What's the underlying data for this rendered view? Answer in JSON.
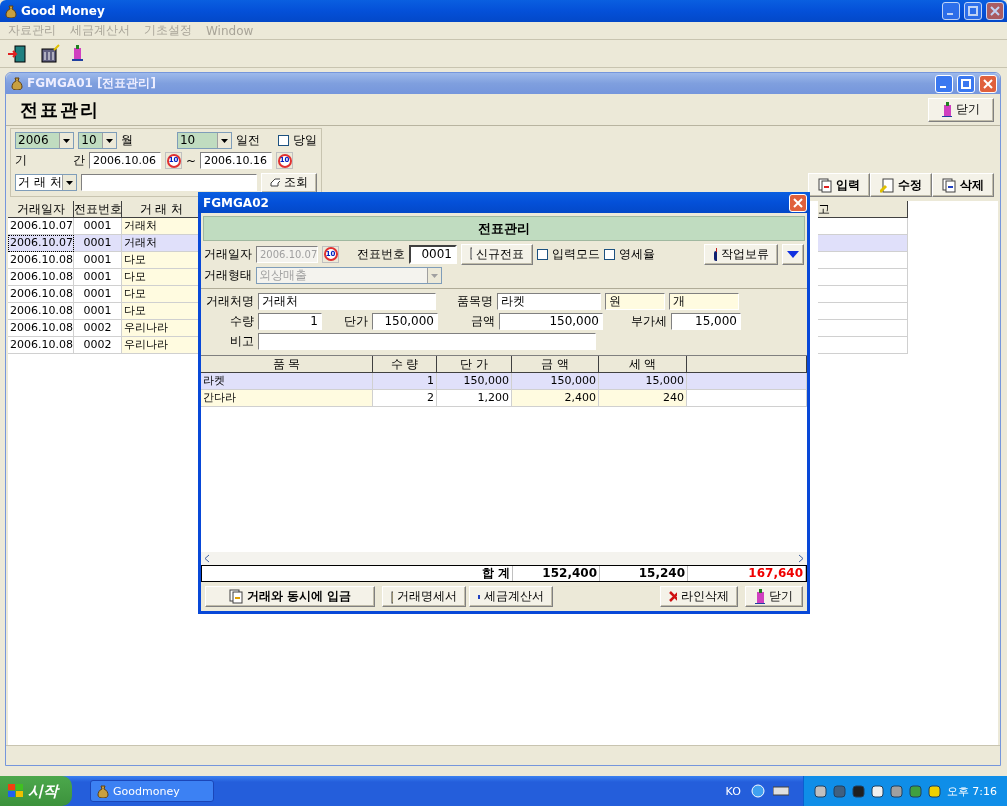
{
  "window": {
    "title": "Good Money"
  },
  "menu": [
    {
      "label": "자료관리",
      "disabled": true
    },
    {
      "label": "세금계산서",
      "disabled": true
    },
    {
      "label": "기초설정",
      "disabled": true
    },
    {
      "label": "Window",
      "disabled": true
    }
  ],
  "child_window": {
    "title": "FGMGA01 [전표관리]",
    "heading": "전표관리",
    "close_button": "닫기",
    "filter": {
      "year": "2006",
      "month": "10",
      "month_label": "월",
      "days": "10",
      "days_label": "일전",
      "today": {
        "label": "당일",
        "checked": false
      },
      "period_label_1": "기",
      "period_label_2": "간",
      "date_from": "2006.10.06",
      "date_to": "2006.10.16",
      "calendar_icon_from": "10",
      "calendar_icon_to": "10",
      "range_sep": "~",
      "field_select": "거 래 처",
      "search_button": "조회"
    },
    "actions": [
      "입력",
      "수정",
      "삭제"
    ],
    "table": {
      "columns": [
        "거래일자",
        "전표번호",
        "거 래 처",
        "고"
      ],
      "rows": [
        {
          "cells": [
            "2006.10.07",
            "0001",
            "거래처"
          ],
          "selected": false
        },
        {
          "cells": [
            "2006.10.07",
            "0001",
            "거래처"
          ],
          "selected": true
        },
        {
          "cells": [
            "2006.10.08",
            "0001",
            "다모"
          ],
          "selected": false
        },
        {
          "cells": [
            "2006.10.08",
            "0001",
            "다모"
          ],
          "selected": false
        },
        {
          "cells": [
            "2006.10.08",
            "0001",
            "다모"
          ],
          "selected": false
        },
        {
          "cells": [
            "2006.10.08",
            "0001",
            "다모"
          ],
          "selected": false
        },
        {
          "cells": [
            "2006.10.08",
            "0002",
            "우리나라"
          ],
          "selected": false
        },
        {
          "cells": [
            "2006.10.08",
            "0002",
            "우리나라"
          ],
          "selected": false
        }
      ]
    }
  },
  "dialog": {
    "title": "FGMGA02",
    "heading": "전표관리",
    "form": {
      "date_label": "거래일자",
      "date": "2006.10.07",
      "date_disabled": true,
      "calendar_icon": "10",
      "slip_label": "전표번호",
      "slip_no": "0001",
      "new_slip_button": "신규전표",
      "input_mode": {
        "label": "입력모드",
        "checked": false
      },
      "zero_rate": {
        "label": "영세율",
        "checked": false
      },
      "hold_button": "작업보류",
      "type_label": "거래형태",
      "type": "외상매출",
      "type_disabled": true,
      "partner_label": "거래처명",
      "partner": "거래처",
      "item_label": "품목명",
      "item": "라켓",
      "unit_1": "원",
      "unit_2": "개",
      "qty_label": "수량",
      "qty": "1",
      "price_label": "단가",
      "price": "150,000",
      "amount_label": "금액",
      "amount": "150,000",
      "vat_label": "부가세",
      "vat": "15,000",
      "memo_label": "비고"
    },
    "grid": {
      "columns": [
        "품 목",
        "수 량",
        "단 가",
        "금 액",
        "세 액"
      ],
      "rows": [
        {
          "cells": [
            "라켓",
            "1",
            "150,000",
            "150,000",
            "15,000"
          ],
          "selected": true
        },
        {
          "cells": [
            "간다라",
            "2",
            "1,200",
            "2,400",
            "240"
          ],
          "selected": false
        }
      ]
    },
    "totals": {
      "label": "합 계",
      "values": [
        "152,400",
        "15,240",
        "167,640"
      ]
    },
    "buttons": [
      {
        "label": "거래와 동시에 입금",
        "kind": "deposit"
      },
      {
        "label": "거래명세서",
        "kind": "statement"
      },
      {
        "label": "세금계산서",
        "kind": "invoice"
      },
      {
        "label": "라인삭제",
        "kind": "delete"
      },
      {
        "label": "닫기",
        "kind": "close"
      }
    ]
  },
  "taskbar": {
    "start": "시작",
    "tasks": [
      "Goodmoney"
    ],
    "language": "KO",
    "clock": "오후 7:16"
  }
}
